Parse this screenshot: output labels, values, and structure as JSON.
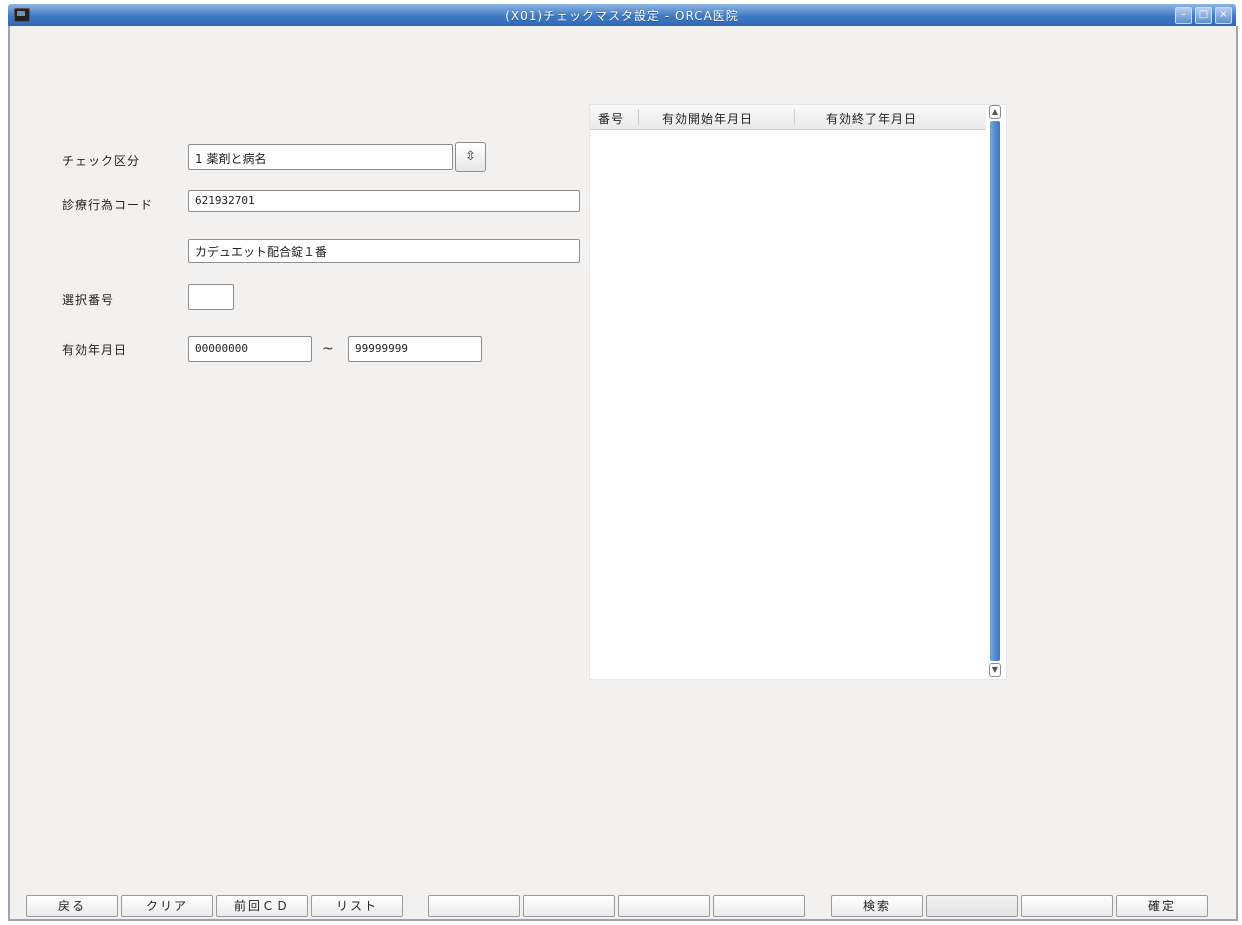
{
  "window": {
    "title": "(X01)チェックマスタ設定 - ORCA医院"
  },
  "form": {
    "check_kubun_label": "チェック区分",
    "check_kubun_value": "1 薬剤と病名",
    "shinryo_code_label": "診療行為コード",
    "shinryo_code_value": "621932701",
    "shinryo_name_value": "カデュエット配合錠１番",
    "sentaku_bango_label": "選択番号",
    "sentaku_bango_value": "",
    "yuko_date_label": "有効年月日",
    "yuko_start_value": "00000000",
    "yuko_tilde": "~",
    "yuko_end_value": "99999999"
  },
  "list": {
    "columns": [
      "番号",
      "有効開始年月日",
      "有効終了年月日"
    ],
    "rows": []
  },
  "function_keys": [
    "戻る",
    "クリア",
    "前回ＣＤ",
    "リスト",
    "",
    "",
    "",
    "",
    "検索",
    "",
    "",
    "確定"
  ]
}
